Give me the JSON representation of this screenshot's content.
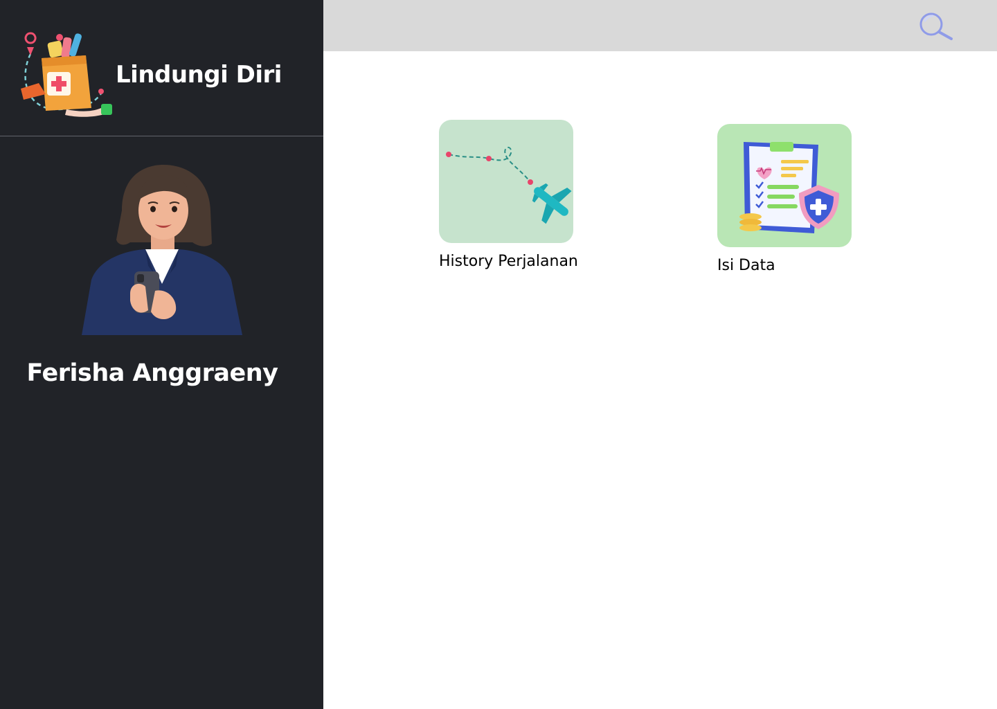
{
  "app": {
    "title": "Lindungi Diri"
  },
  "user": {
    "name": "Ferisha Anggraeny"
  },
  "header": {
    "search_icon": "search-icon"
  },
  "menu": [
    {
      "label": "History Perjalanan",
      "icon": "travel-history-icon",
      "tile_color": "#c6e3cd"
    },
    {
      "label": "Isi Data",
      "icon": "health-form-icon",
      "tile_color": "#b9e6b5"
    }
  ],
  "colors": {
    "sidebar_bg": "#212328",
    "topbar_bg": "#d9d9d9",
    "search_accent": "#8f9be8"
  }
}
